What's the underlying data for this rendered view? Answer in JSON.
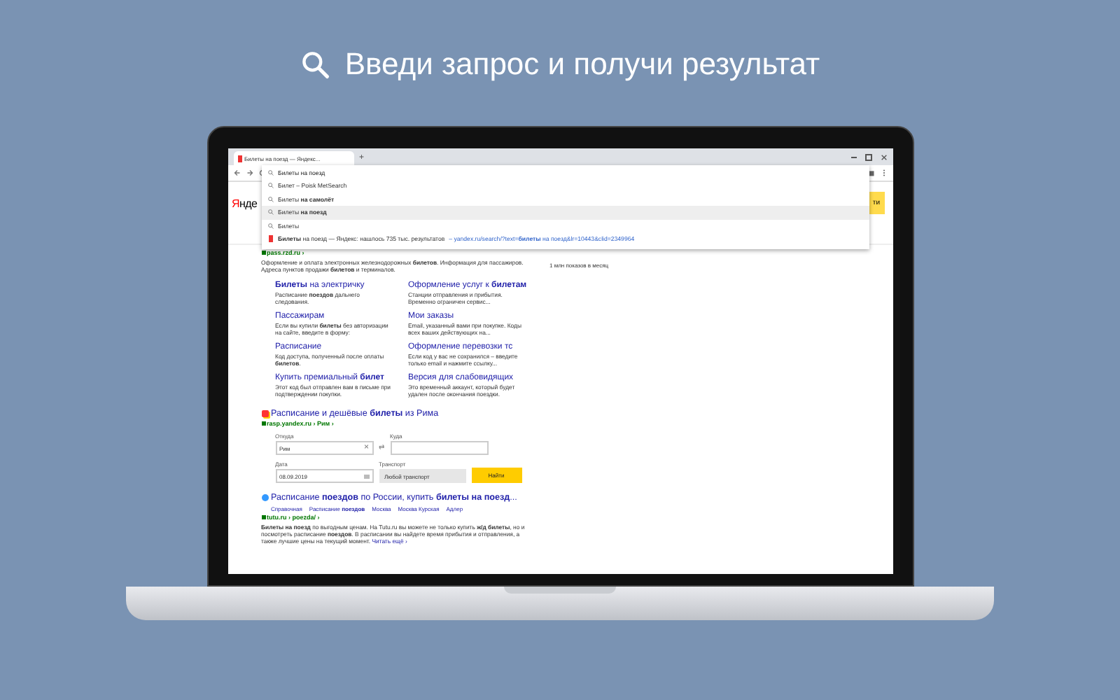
{
  "headline": {
    "text": "Введи запрос и получи результат"
  },
  "browser": {
    "tab_title": "Билеты на поезд — Яндекс...",
    "new_tab": "+",
    "address": "Билеты на поезд"
  },
  "suggestions": [
    {
      "kind": "query",
      "text": "Билет – Poisk MetSearch",
      "selected": false
    },
    {
      "kind": "query",
      "text": "Билеты **на самолёт**",
      "selected": false
    },
    {
      "kind": "query",
      "text": "Билеты **на поезд**",
      "selected": true
    },
    {
      "kind": "query",
      "text": "Билеты",
      "selected": false
    },
    {
      "kind": "site",
      "text": "**Билеты** на поезд — Яндекс: нашлось 735 тыс. результатов",
      "link": "– yandex.ru/search/?text=**билеты** на поезд&lr=10443&clid=2349964",
      "selected": false
    }
  ],
  "page": {
    "logo": {
      "first": "Я",
      "rest": "нде"
    },
    "search_button": "ти",
    "side_text": "1 млн показов в месяц",
    "result_rzd": {
      "url": "pass.rzd.ru ›",
      "snippet": "Оформление и оплата электронных железнодорожных **билетов**. Информация для пассажиров. Адреса пунктов продажи **билетов** и терминалов.",
      "sitelinks": [
        {
          "title": "**Билеты** на электричку",
          "text": "Расписание **поездов** дальнего следования."
        },
        {
          "title": "Оформление услуг к **билетам**",
          "text": "Станции отправления и прибытия. Временно ограничен сервис..."
        },
        {
          "title": "Пассажирам",
          "text": "Если вы купили **билеты** без авторизации на сайте, введите в форму:"
        },
        {
          "title": "Мои заказы",
          "text": "Email, указанный вами при покупке. Коды всех ваших действующих на..."
        },
        {
          "title": "Расписание",
          "text": "Код доступа, полученный после оплаты **билетов**."
        },
        {
          "title": "Оформление перевозки тс",
          "text": "Если код у вас не сохранился – введите только email и нажмите ссылку..."
        },
        {
          "title": "Купить премиальный **билет**",
          "text": "Этот код был отправлен вам в письме при подтверждении покупки."
        },
        {
          "title": "Версия для слабовидящих",
          "text": "Это временный аккаунт, который будет удален после окончания поездки."
        }
      ]
    },
    "result_rasp": {
      "title": "Расписание и дешёвые **билеты** из Рима",
      "url": "rasp.yandex.ru › Рим ›",
      "from_label": "Откуда",
      "from_value": "Рим",
      "clear": "×",
      "swap": "⇄",
      "to_label": "Куда",
      "date_label": "Дата",
      "date_value": "08.09.2019",
      "transport_label": "Транспорт",
      "transport_value": "Любой транспорт",
      "find": "Найти"
    },
    "result_tutu": {
      "title": "Расписание **поездов** по России, купить **билеты на поезд**...",
      "sublinks": [
        "Справочная",
        "Расписание **поездов**",
        "Москва",
        "Москва Курская",
        "Адлер"
      ],
      "url": "tutu.ru › poezda/ ›",
      "snippet": "**Билеты на поезд** по выгодным ценам. На Tutu.ru вы можете не только купить **ж/д билеты**, но и посмотреть расписание **поездов**. В расписании вы найдете время прибытия и отправления, а также лучшие цены на текущий момент.",
      "more": "Читать ещё ›"
    }
  }
}
